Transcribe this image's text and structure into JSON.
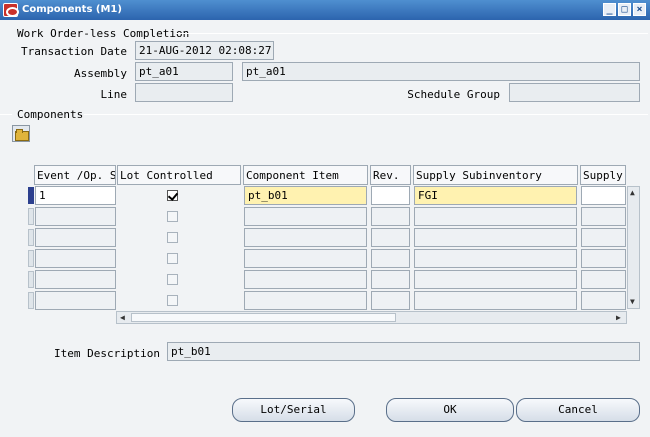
{
  "window": {
    "title": "Components (M1)",
    "minimize": "_",
    "maximize": "□",
    "close": "×"
  },
  "header": {
    "section_title": "Work Order-less Completion",
    "transaction_date_label": "Transaction Date",
    "transaction_date": "21-AUG-2012 02:08:27",
    "assembly_label": "Assembly",
    "assembly": "pt_a01",
    "assembly_desc": "pt_a01",
    "line_label": "Line",
    "line": "",
    "schedule_group_label": "Schedule Group",
    "schedule_group": ""
  },
  "components": {
    "section_title": "Components",
    "columns": [
      "Event /Op. Se",
      "Lot Controlled",
      "Component Item",
      "Rev.",
      "Supply Subinventory",
      "Supply L"
    ],
    "rows": [
      {
        "event": "1",
        "lot_controlled": true,
        "item": "pt_b01",
        "rev": "",
        "subinventory": "FGI",
        "locator": ""
      },
      {
        "event": "",
        "lot_controlled": false,
        "item": "",
        "rev": "",
        "subinventory": "",
        "locator": ""
      },
      {
        "event": "",
        "lot_controlled": false,
        "item": "",
        "rev": "",
        "subinventory": "",
        "locator": ""
      },
      {
        "event": "",
        "lot_controlled": false,
        "item": "",
        "rev": "",
        "subinventory": "",
        "locator": ""
      },
      {
        "event": "",
        "lot_controlled": false,
        "item": "",
        "rev": "",
        "subinventory": "",
        "locator": ""
      },
      {
        "event": "",
        "lot_controlled": false,
        "item": "",
        "rev": "",
        "subinventory": "",
        "locator": ""
      }
    ]
  },
  "item_description_label": "Item Description",
  "item_description": "pt_b01",
  "buttons": {
    "lot_serial": "Lot/Serial",
    "ok": "OK",
    "cancel": "Cancel"
  },
  "colors": {
    "title_bar": "#2c64ae",
    "current_field": "#fff2b0",
    "record_indicator": "#2c3f8e"
  },
  "icons": {
    "app": "oracle-icon",
    "folder": "folder-icon"
  }
}
